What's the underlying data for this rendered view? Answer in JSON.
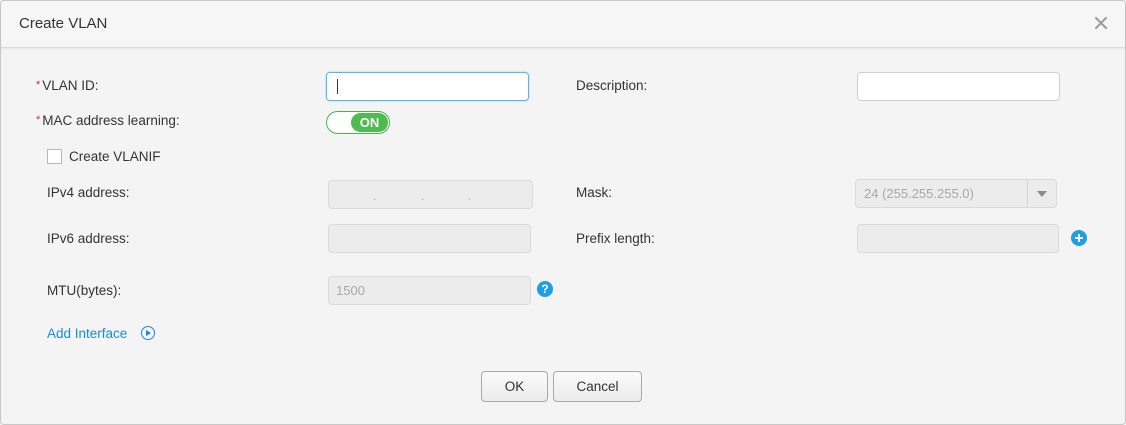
{
  "dialog": {
    "title": "Create VLAN"
  },
  "form": {
    "required_mark": "*",
    "vlan_id": {
      "label": "VLAN ID:",
      "value": ""
    },
    "description": {
      "label": "Description:",
      "value": ""
    },
    "mac_learning": {
      "label": "MAC address learning:",
      "state": "ON"
    },
    "create_vlanif": {
      "label": "Create VLANIF",
      "checked": false
    },
    "ipv4": {
      "label": "IPv4 address:",
      "separator": "."
    },
    "mask": {
      "label": "Mask:",
      "value": "24 (255.255.255.0)"
    },
    "ipv6": {
      "label": "IPv6 address:",
      "value": ""
    },
    "prefix_length": {
      "label": "Prefix length:",
      "value": ""
    },
    "mtu": {
      "label": "MTU(bytes):",
      "value": "1500"
    },
    "help_symbol": "?",
    "add_interface": "Add Interface"
  },
  "buttons": {
    "ok": "OK",
    "cancel": "Cancel"
  },
  "colors": {
    "accent": "#1e9ee6",
    "toggle_on": "#4dbb4f",
    "required": "#e02020",
    "link": "#1a8bd6"
  },
  "icons": {
    "close": "close-icon",
    "help": "help-icon",
    "add": "plus-circle-icon",
    "expand": "play-circle-icon",
    "dropdown": "chevron-down-icon"
  }
}
